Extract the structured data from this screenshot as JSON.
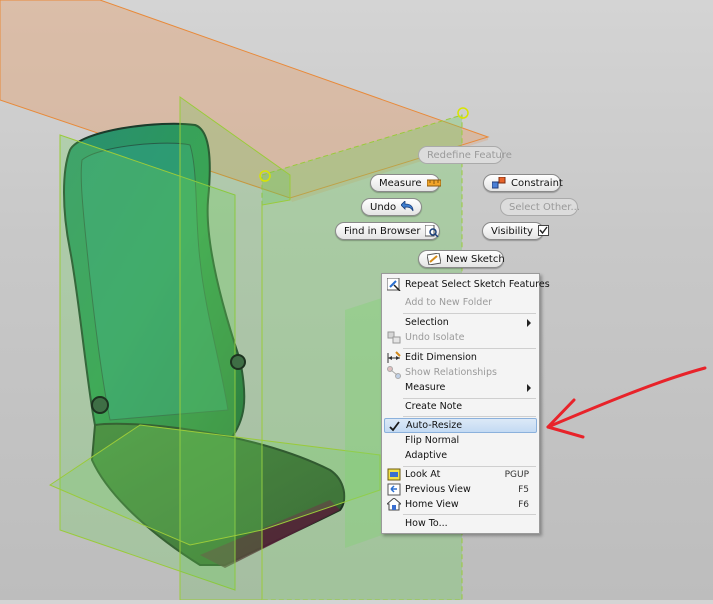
{
  "marking_menu": {
    "redefine_feature": "Redefine Feature",
    "measure": "Measure",
    "constraint": "Constraint",
    "undo": "Undo",
    "select_other": "Select Other...",
    "find_in_browser": "Find in Browser",
    "visibility": "Visibility",
    "new_sketch": "New Sketch"
  },
  "context_menu": {
    "items": [
      {
        "label": "Repeat Select Sketch Features",
        "enabled": true,
        "icon": "sketch-select-icon"
      },
      {
        "label": "Add to New Folder",
        "enabled": false
      },
      {
        "label": "Selection",
        "enabled": true,
        "submenu": true
      },
      {
        "label": "Undo Isolate",
        "enabled": false,
        "icon": "isolate-icon"
      },
      {
        "label": "Edit Dimension",
        "enabled": true,
        "icon": "dimension-icon"
      },
      {
        "label": "Show Relationships",
        "enabled": false,
        "icon": "relationships-icon"
      },
      {
        "label": "Measure",
        "enabled": true,
        "submenu": true
      },
      {
        "label": "Create Note",
        "enabled": true
      },
      {
        "label": "Auto-Resize",
        "enabled": true,
        "checked": true,
        "highlighted": true
      },
      {
        "label": "Flip Normal",
        "enabled": true
      },
      {
        "label": "Adaptive",
        "enabled": true
      },
      {
        "label": "Look At",
        "enabled": true,
        "shortcut": "PGUP",
        "icon": "look-at-icon"
      },
      {
        "label": "Previous View",
        "enabled": true,
        "shortcut": "F5",
        "icon": "previous-view-icon"
      },
      {
        "label": "Home View",
        "enabled": true,
        "shortcut": "F6",
        "icon": "home-view-icon"
      },
      {
        "label": "How To...",
        "enabled": true
      }
    ]
  },
  "colors": {
    "work_plane_green": "#4fc24a",
    "work_plane_orange": "#e8945a",
    "annotation_arrow": "#e8232a",
    "menu_highlight": "#c3daf3"
  }
}
